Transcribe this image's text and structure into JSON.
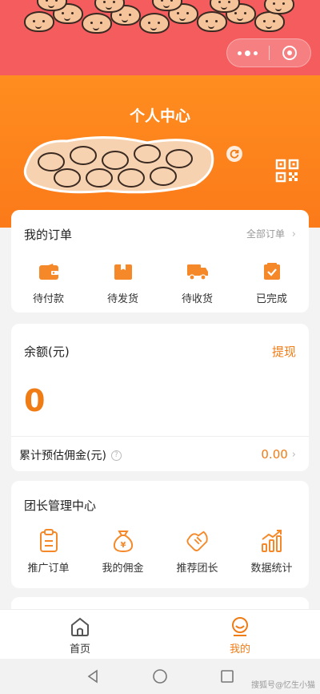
{
  "colors": {
    "accent": "#f07c16",
    "status_bar": "#f45c5e",
    "header": "#ff8d1f"
  },
  "capsule": {
    "more_icon": "more-dots-icon",
    "close_icon": "target-close-icon"
  },
  "header": {
    "title": "个人中心"
  },
  "orders": {
    "title": "我的订单",
    "all_label": "全部订单",
    "items": [
      {
        "label": "待付款",
        "icon": "wallet-icon"
      },
      {
        "label": "待发货",
        "icon": "package-icon"
      },
      {
        "label": "待收货",
        "icon": "truck-icon"
      },
      {
        "label": "已完成",
        "icon": "check-box-icon"
      }
    ]
  },
  "balance": {
    "title": "余额(元)",
    "withdraw_label": "提现",
    "amount": "0",
    "commission_label": "累计预估佣金(元)",
    "commission_value": "0.00"
  },
  "leader": {
    "title": "团长管理中心",
    "items": [
      {
        "label": "推广订单",
        "icon": "clipboard-icon"
      },
      {
        "label": "我的佣金",
        "icon": "money-bag-icon"
      },
      {
        "label": "推荐团长",
        "icon": "handshake-icon"
      },
      {
        "label": "数据统计",
        "icon": "bar-chart-icon"
      }
    ]
  },
  "tabbar": {
    "items": [
      {
        "label": "首页",
        "icon": "home-icon",
        "active": false
      },
      {
        "label": "我的",
        "icon": "profile-icon",
        "active": true
      }
    ]
  },
  "watermark": "搜狐号@忆生小猫"
}
